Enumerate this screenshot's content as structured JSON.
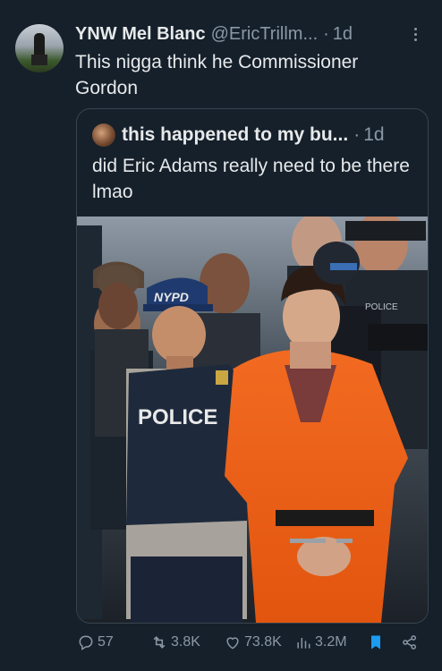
{
  "tweet": {
    "display_name": "YNW Mel Blanc",
    "handle": "@EricTrillm...",
    "separator": "·",
    "time": "1d",
    "text": "This nigga think he Commissioner Gordon"
  },
  "quoted_tweet": {
    "display_name": "this happened to my bu...",
    "separator": "·",
    "time": "1d",
    "text": "did Eric Adams really need to be there lmao",
    "image_text": {
      "cap": "NYPD",
      "vest": "POLICE",
      "vest_back": "POLICE"
    }
  },
  "actions": {
    "replies": "57",
    "reposts": "3.8K",
    "likes": "73.8K",
    "views": "3.2M"
  },
  "icons": {
    "more": "more-dots-icon",
    "reply": "reply-icon",
    "repost": "repost-icon",
    "like": "heart-icon",
    "views": "views-bar-icon",
    "bookmark": "bookmark-icon",
    "share": "share-icon"
  },
  "colors": {
    "background": "#15202b",
    "text": "#e7e9ea",
    "secondary": "#8b98a5",
    "border": "#38444d",
    "bookmark": "#1d9bf0"
  }
}
